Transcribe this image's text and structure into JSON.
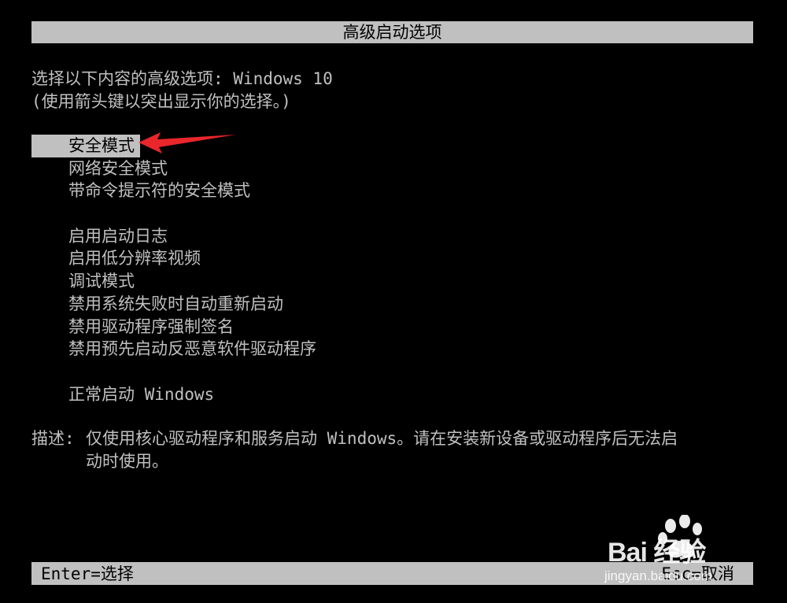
{
  "title": "高级启动选项",
  "prompt": {
    "line1": "选择以下内容的高级选项: Windows 10",
    "line2": "(使用箭头键以突出显示你的选择。)"
  },
  "menu": {
    "selected_index": 0,
    "group1": [
      {
        "label": "安全模式"
      },
      {
        "label": "网络安全模式"
      },
      {
        "label": "带命令提示符的安全模式"
      }
    ],
    "group2": [
      {
        "label": "启用启动日志"
      },
      {
        "label": "启用低分辨率视频"
      },
      {
        "label": "调试模式"
      },
      {
        "label": "禁用系统失败时自动重新启动"
      },
      {
        "label": "禁用驱动程序强制签名"
      },
      {
        "label": "禁用预先启动反恶意软件驱动程序"
      }
    ],
    "group3": [
      {
        "label": "正常启动 Windows"
      }
    ]
  },
  "description": {
    "label": "描述:",
    "line1": "仅使用核心驱动程序和服务启动 Windows。请在安装新设备或驱动程序后无法启",
    "line2": "动时使用。"
  },
  "footer": {
    "left": "Enter=选择",
    "right": "Esc=取消"
  },
  "watermark": {
    "brand": "Bai 经验",
    "sub": "jingyan.baidu.com"
  },
  "colors": {
    "background": "#000000",
    "text": "#c0c0c0",
    "bar": "#c0c0c0",
    "arrow": "#e8262b"
  }
}
